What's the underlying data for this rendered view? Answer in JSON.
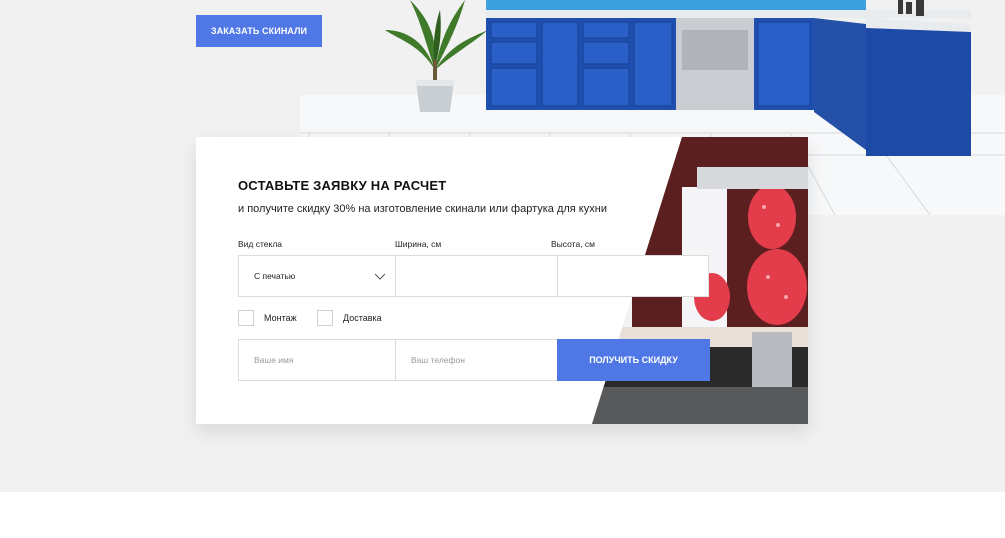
{
  "hero": {
    "order_button": "ЗАКАЗАТЬ СКИНАЛИ"
  },
  "form": {
    "title": "ОСТАВЬТЕ ЗАЯВКУ НА РАСЧЕТ",
    "subtitle": "и получите скидку 30% на изготовление скинали или фартука для кухни",
    "glass_label": "Вид стекла",
    "width_label": "Ширина, см",
    "height_label": "Высота, см",
    "glass_value": "С печатью",
    "width_value": "",
    "height_value": "",
    "mount_label": "Монтаж",
    "delivery_label": "Доставка",
    "name_placeholder": "Ваше имя",
    "phone_placeholder": "Ваш телефон",
    "submit_label": "ПОЛУЧИТЬ СКИДКУ"
  },
  "colors": {
    "accent": "#4f78e6",
    "cabinet_blue": "#1f4fb0",
    "background": "#f1f1f1"
  },
  "icons": [
    "chevron-down-icon",
    "checkbox-icon"
  ]
}
